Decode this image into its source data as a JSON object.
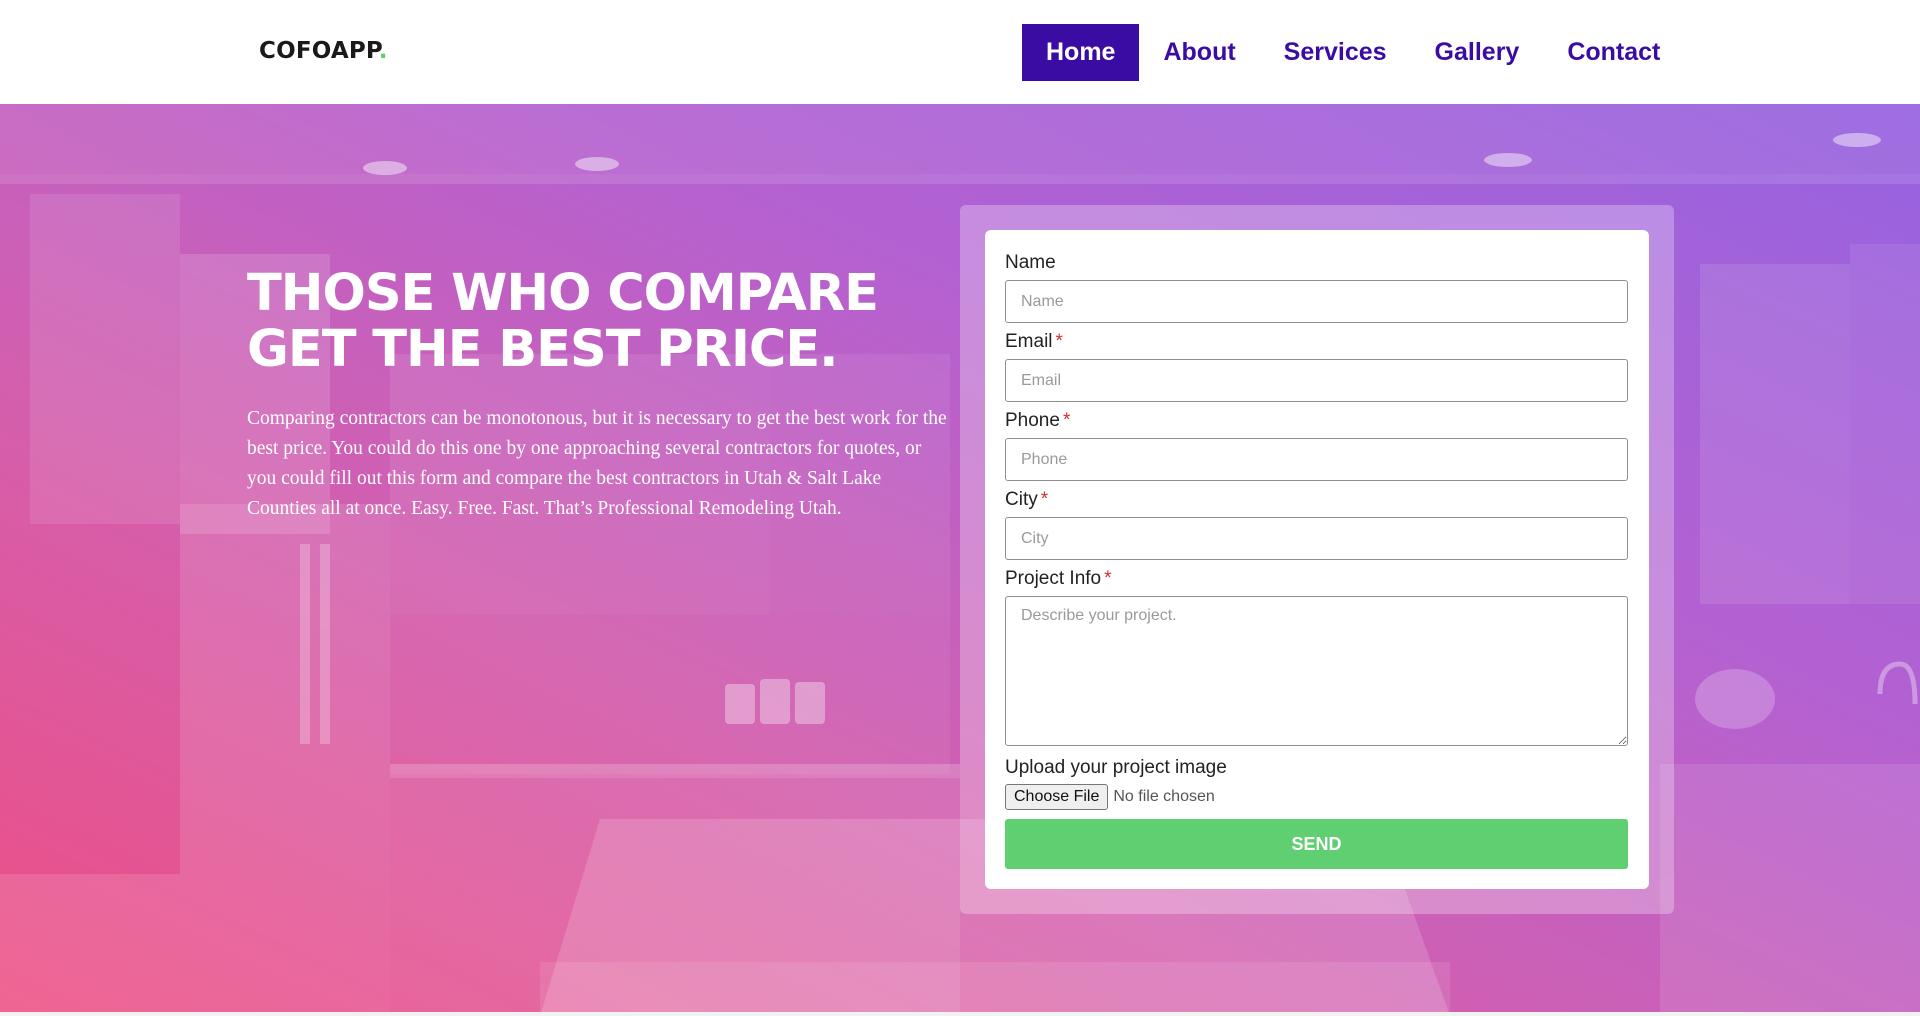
{
  "header": {
    "logo_text": "COFOAPP",
    "logo_dot": ".",
    "nav": [
      {
        "label": "Home",
        "active": true
      },
      {
        "label": "About",
        "active": false
      },
      {
        "label": "Services",
        "active": false
      },
      {
        "label": "Gallery",
        "active": false
      },
      {
        "label": "Contact",
        "active": false
      }
    ]
  },
  "hero": {
    "headline_line1": "THOSE WHO COMPARE",
    "headline_line2": "GET THE BEST PRICE.",
    "intro": "Comparing contractors can be monotonous, but it is necessary to get the best work for the best price. You could do this one by one approaching several contractors for quotes, or you could fill out this form and compare the best contractors in Utah & Salt Lake Counties all at once. Easy. Free. Fast. That’s Professional Remodeling Utah.",
    "gradient_colors": [
      "#ee4f84",
      "#d35fae",
      "#b461d1",
      "#9662e0"
    ]
  },
  "form": {
    "name_label": "Name",
    "name_placeholder": "Name",
    "email_label": "Email",
    "email_placeholder": "Email",
    "phone_label": "Phone",
    "phone_placeholder": "Phone",
    "city_label": "City",
    "city_placeholder": "City",
    "project_label": "Project Info",
    "project_placeholder": "Describe your project.",
    "required_mark": "*",
    "upload_label": "Upload your project image",
    "choose_file_label": "Choose File",
    "file_status": "No file chosen",
    "send_label": "SEND"
  },
  "colors": {
    "brand_purple": "#3a0ca3",
    "send_green": "#5fcf71",
    "logo_dot_green": "#5fd06f",
    "required_red": "#d32f2f"
  }
}
